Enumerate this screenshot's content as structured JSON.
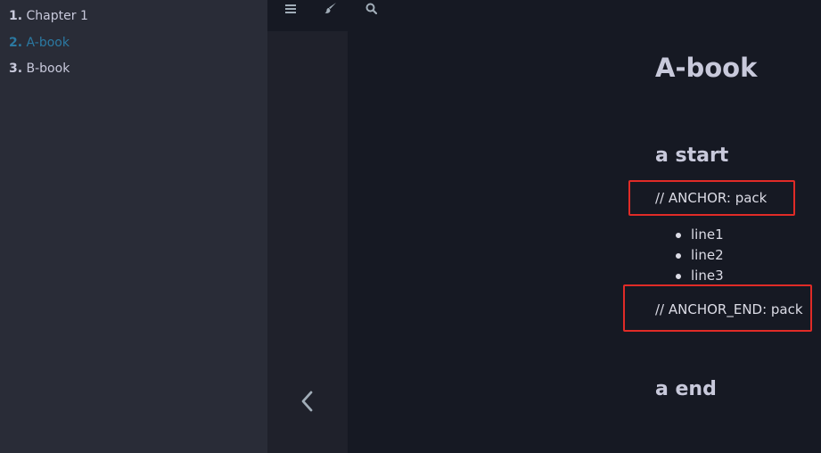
{
  "sidebar": {
    "items": [
      {
        "num": "1.",
        "label": "Chapter 1",
        "active": false
      },
      {
        "num": "2.",
        "label": "A-book",
        "active": true
      },
      {
        "num": "3.",
        "label": "B-book",
        "active": false
      }
    ]
  },
  "toolbar": {
    "icons": [
      "menu-icon",
      "paintbrush-icon",
      "search-icon"
    ]
  },
  "nav": {
    "prev_icon": "chevron-left-icon"
  },
  "content": {
    "title": "A-book",
    "heading_start": "a start",
    "anchor_line": "// ANCHOR: pack",
    "list_items": [
      "line1",
      "line2",
      "line3"
    ],
    "anchor_end_line": "// ANCHOR_END: pack",
    "heading_end": "a end"
  },
  "colors": {
    "sidebar_bg": "#292c37",
    "content_bg": "#161923",
    "active_link": "#2b79a2",
    "highlight": "#e02b27"
  }
}
